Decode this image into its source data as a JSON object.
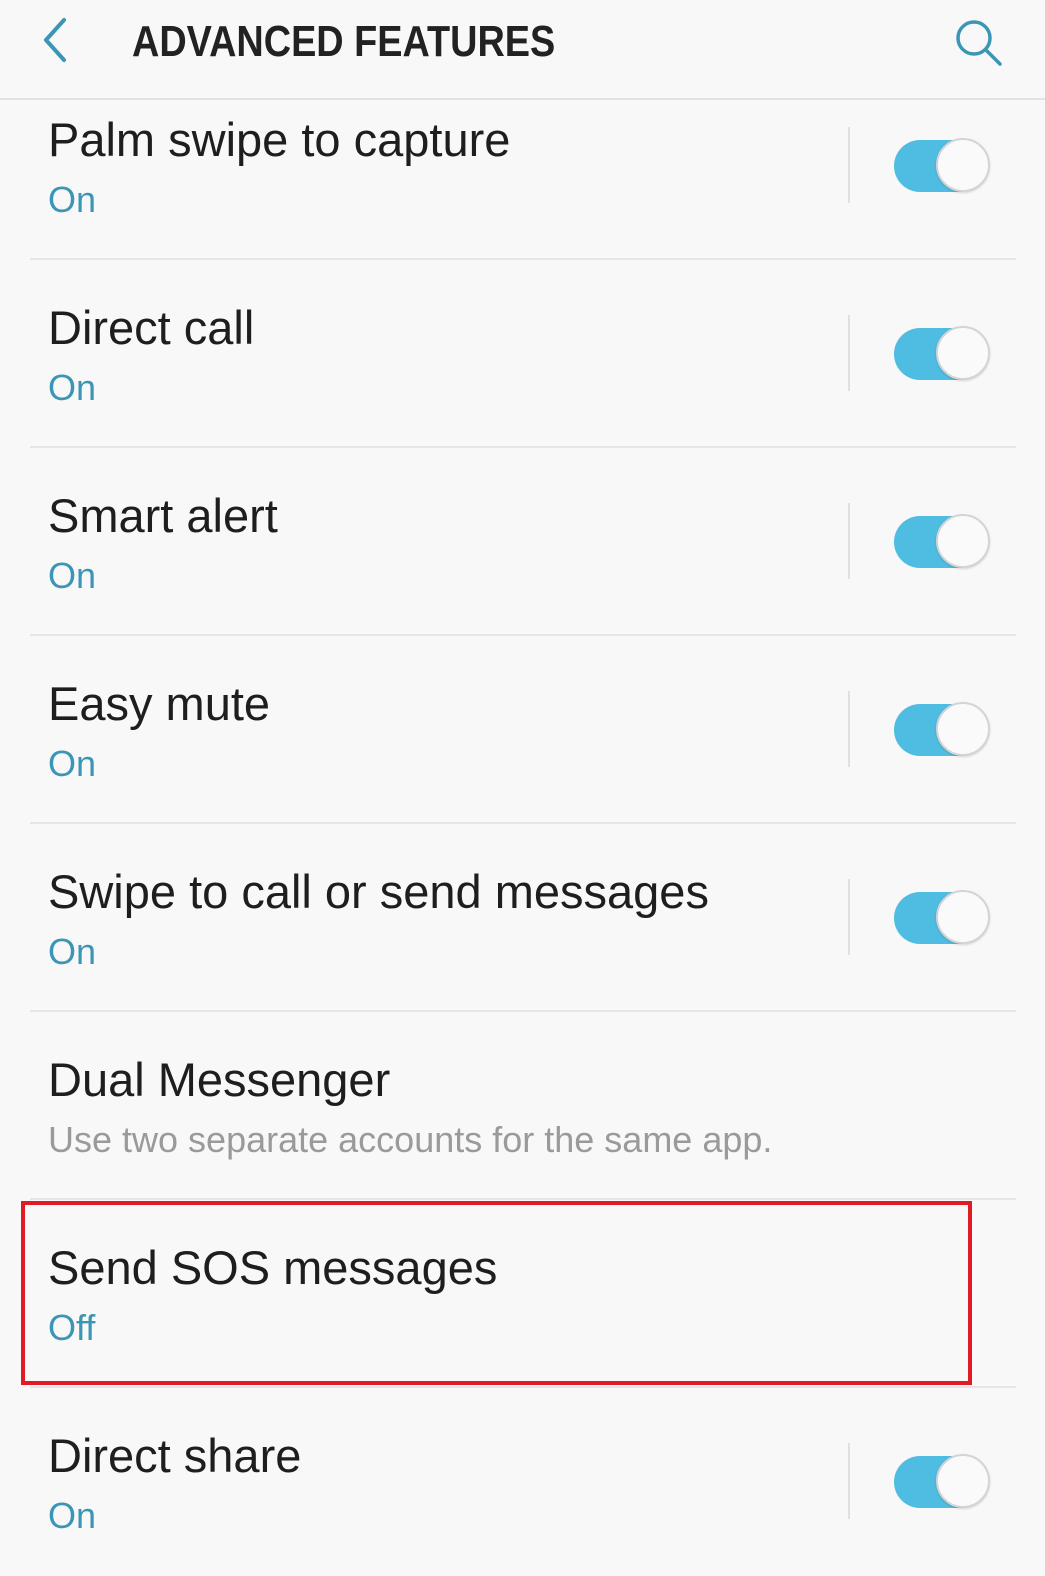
{
  "header": {
    "title": "ADVANCED FEATURES",
    "back_icon": "chevron-left-icon",
    "search_icon": "search-icon"
  },
  "colors": {
    "accent": "#4fbde2",
    "status_text": "#3b96b6",
    "highlight": "#e01b24"
  },
  "items": [
    {
      "title": "Palm swipe to capture",
      "status": "On",
      "toggle": true
    },
    {
      "title": "Direct call",
      "status": "On",
      "toggle": true
    },
    {
      "title": "Smart alert",
      "status": "On",
      "toggle": true
    },
    {
      "title": "Easy mute",
      "status": "On",
      "toggle": true
    },
    {
      "title": "Swipe to call or send messages",
      "status": "On",
      "toggle": true
    },
    {
      "title": "Dual Messenger",
      "description": "Use two separate accounts for the same app."
    },
    {
      "title": "Send SOS messages",
      "status": "Off"
    },
    {
      "title": "Direct share",
      "status": "On",
      "toggle": true
    }
  ]
}
